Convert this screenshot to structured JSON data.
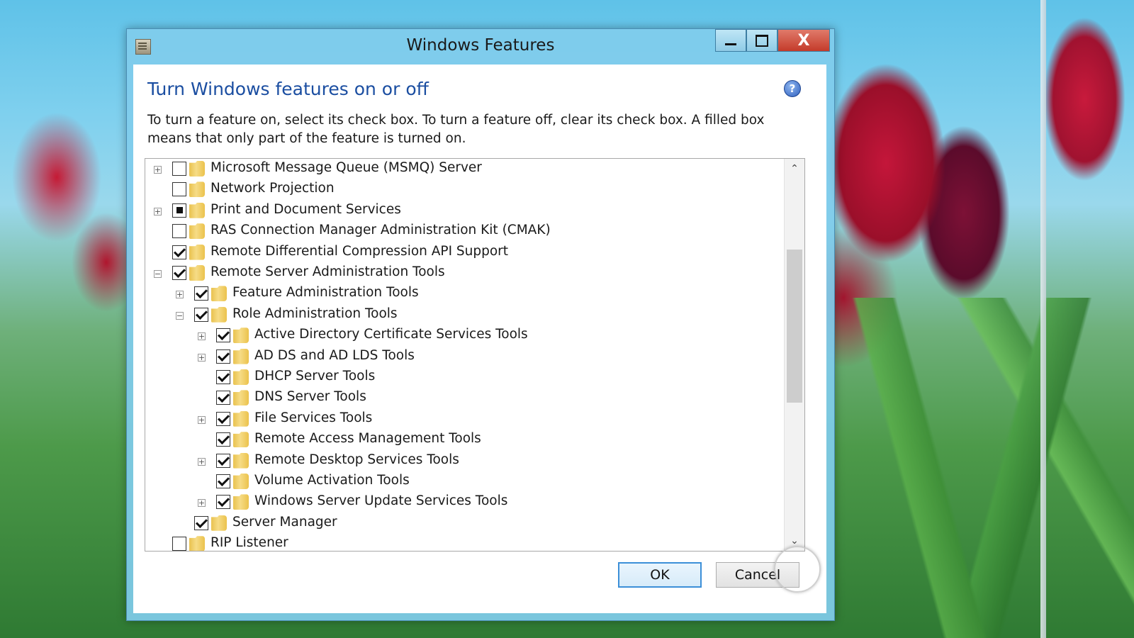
{
  "window": {
    "title": "Windows Features",
    "minimize_label": "",
    "maximize_label": "",
    "close_label": "X"
  },
  "dialog": {
    "heading": "Turn Windows features on or off",
    "help_glyph": "?",
    "description": "To turn a feature on, select its check box. To turn a feature off, clear its check box. A filled box means that only part of the feature is turned on."
  },
  "features": [
    {
      "label": "Microsoft Message Queue (MSMQ) Server",
      "level": 0,
      "expander": "+",
      "state": "unchecked"
    },
    {
      "label": "Network Projection",
      "level": 0,
      "expander": "",
      "state": "unchecked"
    },
    {
      "label": "Print and Document Services",
      "level": 0,
      "expander": "+",
      "state": "partial"
    },
    {
      "label": "RAS Connection Manager Administration Kit (CMAK)",
      "level": 0,
      "expander": "",
      "state": "unchecked"
    },
    {
      "label": "Remote Differential Compression API Support",
      "level": 0,
      "expander": "",
      "state": "checked"
    },
    {
      "label": "Remote Server Administration Tools",
      "level": 0,
      "expander": "−",
      "state": "checked"
    },
    {
      "label": "Feature Administration Tools",
      "level": 1,
      "expander": "+",
      "state": "checked"
    },
    {
      "label": "Role Administration Tools",
      "level": 1,
      "expander": "−",
      "state": "checked"
    },
    {
      "label": "Active Directory Certificate Services Tools",
      "level": 2,
      "expander": "+",
      "state": "checked"
    },
    {
      "label": "AD DS and AD LDS Tools",
      "level": 2,
      "expander": "+",
      "state": "checked"
    },
    {
      "label": "DHCP Server Tools",
      "level": 2,
      "expander": "",
      "state": "checked"
    },
    {
      "label": "DNS Server Tools",
      "level": 2,
      "expander": "",
      "state": "checked"
    },
    {
      "label": "File Services Tools",
      "level": 2,
      "expander": "+",
      "state": "checked"
    },
    {
      "label": "Remote Access Management Tools",
      "level": 2,
      "expander": "",
      "state": "checked"
    },
    {
      "label": "Remote Desktop Services Tools",
      "level": 2,
      "expander": "+",
      "state": "checked"
    },
    {
      "label": "Volume Activation Tools",
      "level": 2,
      "expander": "",
      "state": "checked"
    },
    {
      "label": "Windows Server Update Services Tools",
      "level": 2,
      "expander": "+",
      "state": "checked"
    },
    {
      "label": "Server Manager",
      "level": 1,
      "expander": "",
      "state": "checked"
    },
    {
      "label": "RIP Listener",
      "level": 0,
      "expander": "",
      "state": "unchecked"
    }
  ],
  "scrollbar": {
    "up_glyph": "⌃",
    "down_glyph": "⌄"
  },
  "buttons": {
    "ok": "OK",
    "cancel": "Cancel"
  }
}
